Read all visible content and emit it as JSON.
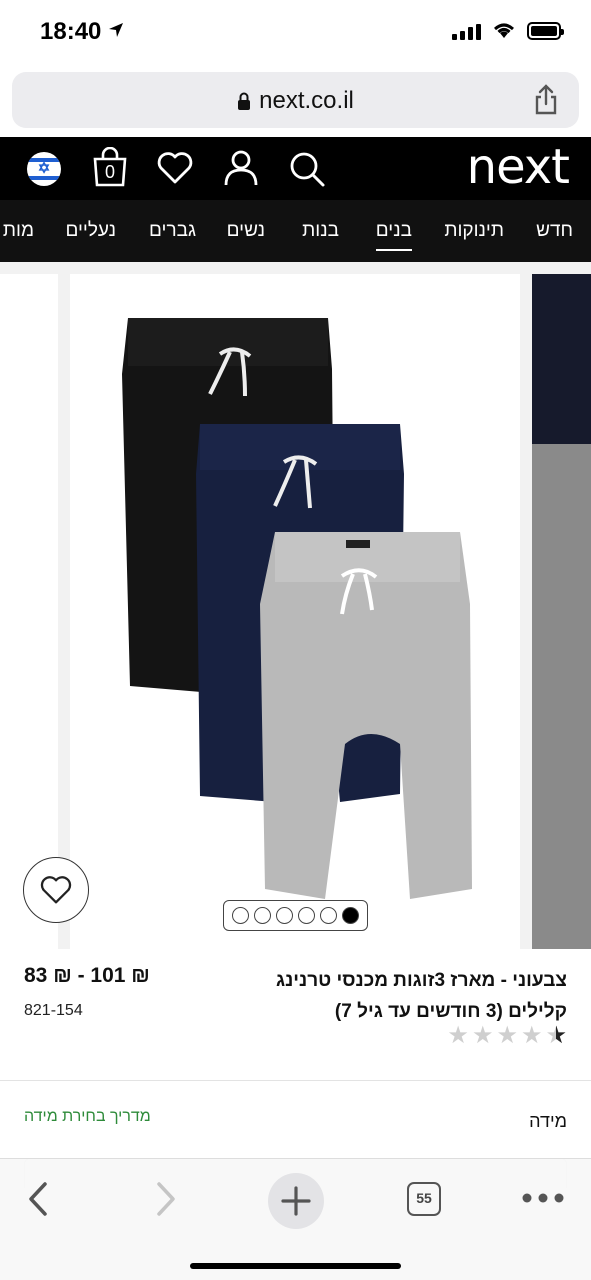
{
  "status_bar": {
    "time": "18:40"
  },
  "browser": {
    "url": "next.co.il",
    "tab_count": "55"
  },
  "header": {
    "logo": "next",
    "bag_count": "0",
    "flag_symbol": "✡"
  },
  "nav": {
    "items": [
      {
        "label": "חדש",
        "active": false
      },
      {
        "label": "תינוקות",
        "active": false
      },
      {
        "label": "בנים",
        "active": true
      },
      {
        "label": "בנות",
        "active": false
      },
      {
        "label": "נשים",
        "active": false
      },
      {
        "label": "גברים",
        "active": false
      },
      {
        "label": "נעליים",
        "active": false
      },
      {
        "label": "מות",
        "active": false
      }
    ]
  },
  "product": {
    "title_line1": "צבעוני - מארז 3זוגות מכנסי טרנינג",
    "title_line2": "קלילים (3 חודשים עד גיל 7)",
    "price": "83 ₪ - 101 ₪",
    "sku": "821-154",
    "rating": 4.5,
    "rating_max": 5,
    "image_count": 6,
    "active_image": 6
  },
  "size": {
    "label": "מידה",
    "guide_link": "מדריך בחירת מידה"
  },
  "colors": {
    "black_pants": "#111111",
    "navy_pants": "#17203f",
    "grey_pants": "#b9b9b9",
    "guide_link": "#2e8b3a"
  }
}
